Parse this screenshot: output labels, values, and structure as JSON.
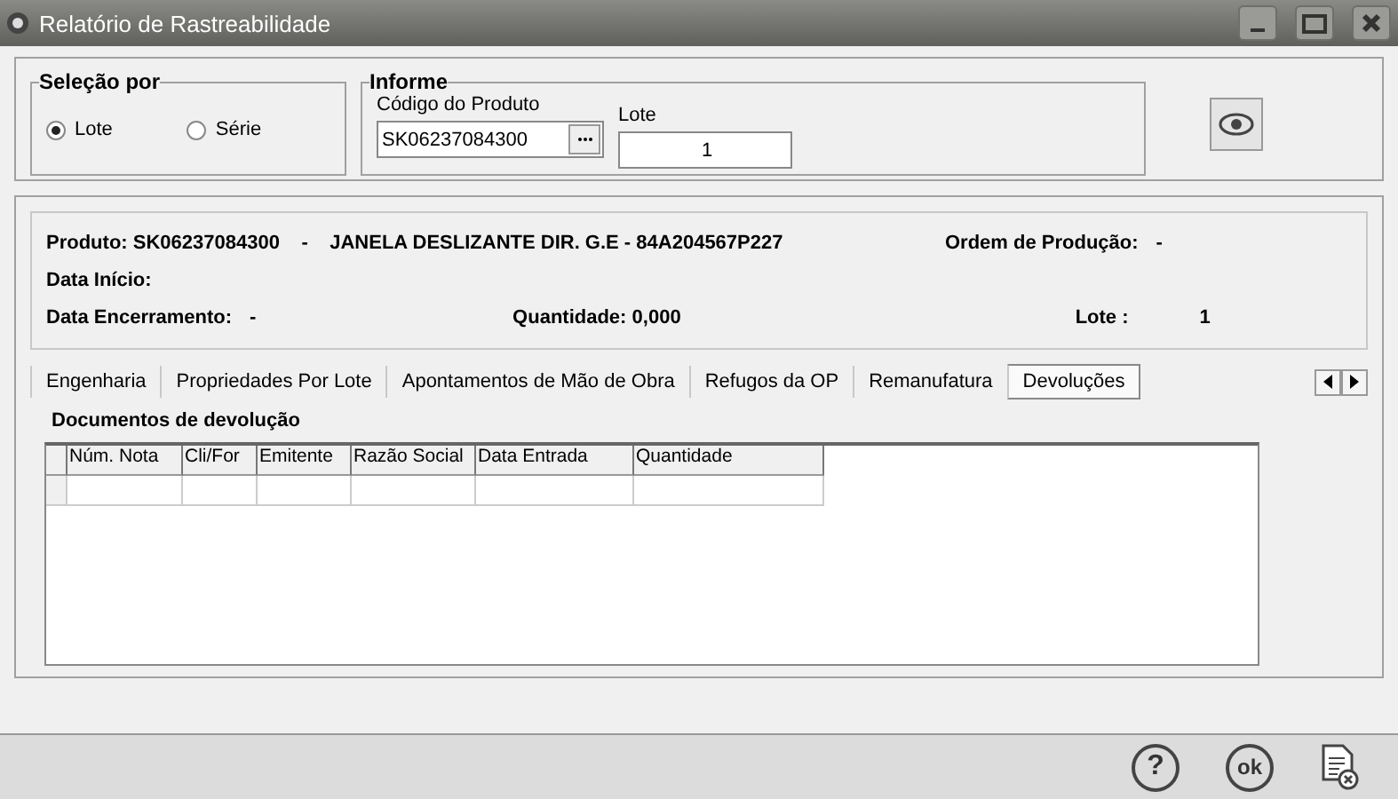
{
  "window": {
    "title": "Relatório de Rastreabilidade"
  },
  "selecao": {
    "title": "Seleção por",
    "options": [
      {
        "label": "Lote",
        "selected": true
      },
      {
        "label": "Série",
        "selected": false
      }
    ]
  },
  "informe": {
    "title": "Informe",
    "fields": [
      {
        "label": "Código do Produto",
        "value": "SK06237084300",
        "lookup": true
      },
      {
        "label": "Lote",
        "value": "1",
        "lookup": false
      }
    ]
  },
  "info": {
    "produto_label": "Produto:",
    "produto": "SK06237084300",
    "sep": "-",
    "descricao": "JANELA DESLIZANTE DIR. G.E - 84A204567P227",
    "ordem_label": "Ordem de Produção:",
    "ordem": "-",
    "inicio_label": "Data Início:",
    "encerramento_label": "Data Encerramento:",
    "encerramento": "-",
    "quantidade_label": "Quantidade:",
    "quantidade": "0,000",
    "lote_label": "Lote :",
    "lote": "1"
  },
  "tabs": [
    {
      "label": "Engenharia",
      "selected": false
    },
    {
      "label": "Propriedades Por Lote",
      "selected": false
    },
    {
      "label": "Apontamentos de Mão de Obra",
      "selected": false
    },
    {
      "label": "Refugos da OP",
      "selected": false
    },
    {
      "label": "Remanufatura",
      "selected": false
    },
    {
      "label": "Devoluções",
      "selected": true
    }
  ],
  "section_title": "Documentos de devolução",
  "table": {
    "columns": [
      "Núm. Nota",
      "Cli/For",
      "Emitente",
      "Razão Social",
      "Data Entrada",
      "Quantidade"
    ]
  },
  "footer_buttons": [
    {
      "kind": "help",
      "label": "?"
    },
    {
      "kind": "ok",
      "label": "ok"
    },
    {
      "kind": "cancel"
    }
  ]
}
